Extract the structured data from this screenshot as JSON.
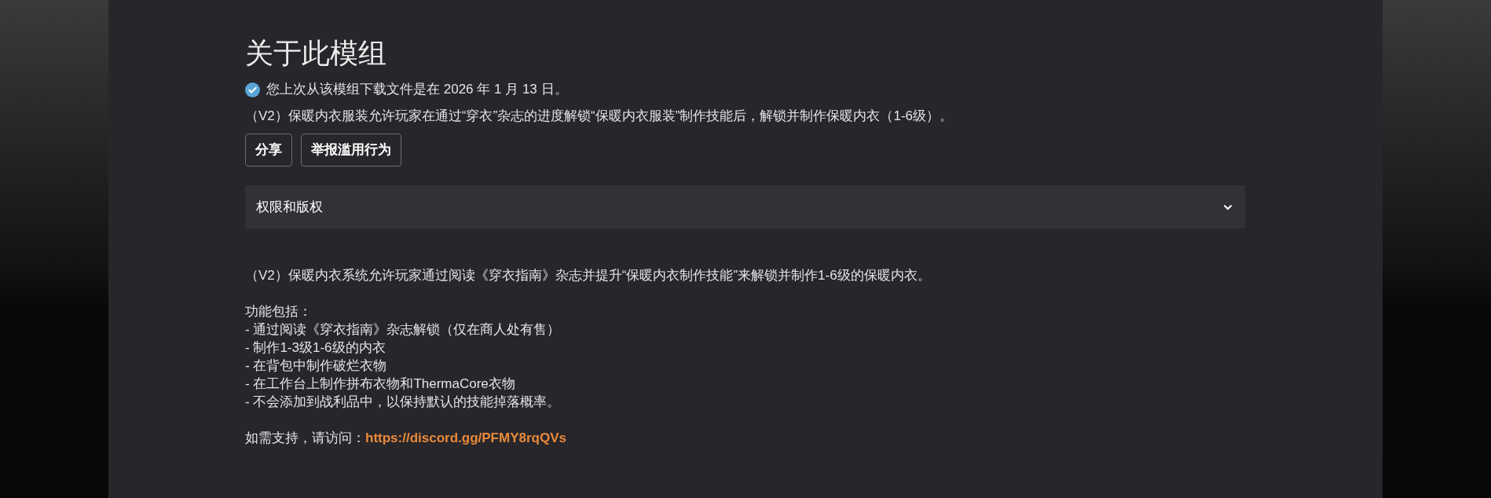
{
  "title": "关于此模组",
  "download_notice": {
    "text": "您上次从该模组下载文件是在 2026 年 1 月 13 日。"
  },
  "summary": "（V2）保暖内衣服装允许玩家在通过“穿衣”杂志的进度解锁“保暖内衣服装”制作技能后，解锁并制作保暖内衣（1-6级）。",
  "buttons": [
    "分享",
    "举报滥用行为"
  ],
  "accordion": {
    "label": "权限和版权",
    "expanded": false
  },
  "description": "（V2）保暖内衣系统允许玩家通过阅读《穿衣指南》杂志并提升“保暖内衣制作技能”来解锁并制作1-6级的保暖内衣。",
  "features_heading": "功能包括：",
  "features": [
    "- 通过阅读《穿衣指南》杂志解锁（仅在商人处有售）",
    "- 制作1-3级1-6级的内衣",
    "- 在背包中制作破烂衣物",
    "- 在工作台上制作拼布衣物和ThermaCore衣物",
    "- 不会添加到战利品中，以保持默认的技能掉落概率。"
  ],
  "support": {
    "text": "如需支持，请访问：",
    "link": "https://discord.gg/PFMY8rqQVs"
  }
}
